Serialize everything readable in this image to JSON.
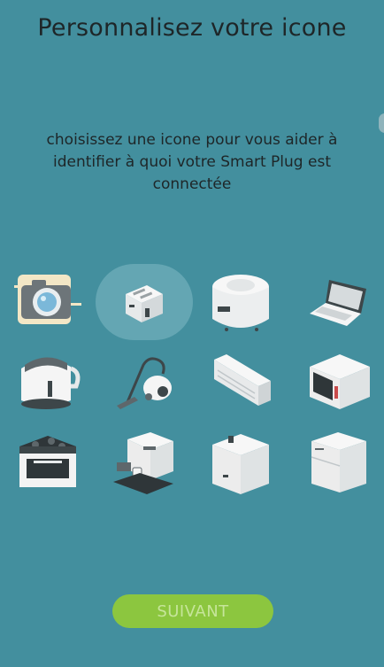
{
  "header": {
    "title": "Personnalisez votre icone"
  },
  "instructions": "choisissez une icone pour vous aider à identifier à quoi votre Smart Plug est connectée",
  "icons": [
    {
      "name": "camera-icon",
      "selected": false
    },
    {
      "name": "toaster-icon",
      "selected": true
    },
    {
      "name": "rice-cooker-icon",
      "selected": false
    },
    {
      "name": "laptop-icon",
      "selected": false
    },
    {
      "name": "kettle-icon",
      "selected": false
    },
    {
      "name": "vacuum-cleaner-icon",
      "selected": false
    },
    {
      "name": "air-conditioner-icon",
      "selected": false
    },
    {
      "name": "microwave-icon",
      "selected": false
    },
    {
      "name": "stove-icon",
      "selected": false
    },
    {
      "name": "coffee-machine-icon",
      "selected": false
    },
    {
      "name": "water-heater-icon",
      "selected": false
    },
    {
      "name": "fridge-icon",
      "selected": false
    }
  ],
  "footer": {
    "next_label": "SUIVANT"
  },
  "colors": {
    "background": "#438F9E",
    "accent": "#8CC63F",
    "selection": "#6AAAB6"
  }
}
